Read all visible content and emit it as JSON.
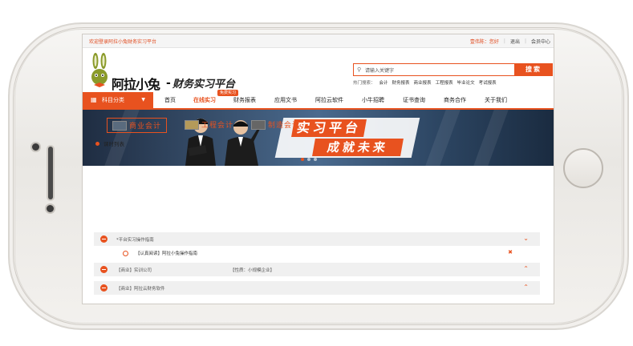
{
  "topbar": {
    "welcome": "欢迎登录阿拉小兔财务实习平台",
    "user": "壹伟陈：您好",
    "logout": "退出",
    "member_center": "会员中心"
  },
  "logo": {
    "brand": "阿拉小兔",
    "dash": "-",
    "slogan": "财务实习平台"
  },
  "search": {
    "placeholder": "请输入关键字",
    "button": "搜索",
    "hot_label": "热门搜索：",
    "hot_words": [
      "会计",
      "财务报表",
      "商业报表",
      "工程报表",
      "毕业论文",
      "考试报表"
    ]
  },
  "nav": {
    "category": "科目分类",
    "badge": "免费实习",
    "items": [
      "首页",
      "在线实习",
      "财务报表",
      "应用文书",
      "阿拉云软件",
      "小牛招聘",
      "证书查询",
      "商务合作",
      "关于我们"
    ]
  },
  "banner": {
    "line1": "实习平台",
    "line2": "成就未来"
  },
  "tabs": [
    "商业会计",
    "工程会计",
    "制造会计"
  ],
  "list": {
    "title": "课时列表",
    "rows": [
      {
        "name": "*平台实习操作指南",
        "property": ""
      },
      {
        "name": "【商业】实训公司",
        "property": "【性质：小规模企业】"
      },
      {
        "name": "【商业】阿拉云财务软件",
        "property": ""
      }
    ],
    "sub_item": "【认真阅读】阿拉小兔操作指南"
  },
  "colors": {
    "accent": "#e8521f",
    "row_bg": "#f0f0f0"
  }
}
